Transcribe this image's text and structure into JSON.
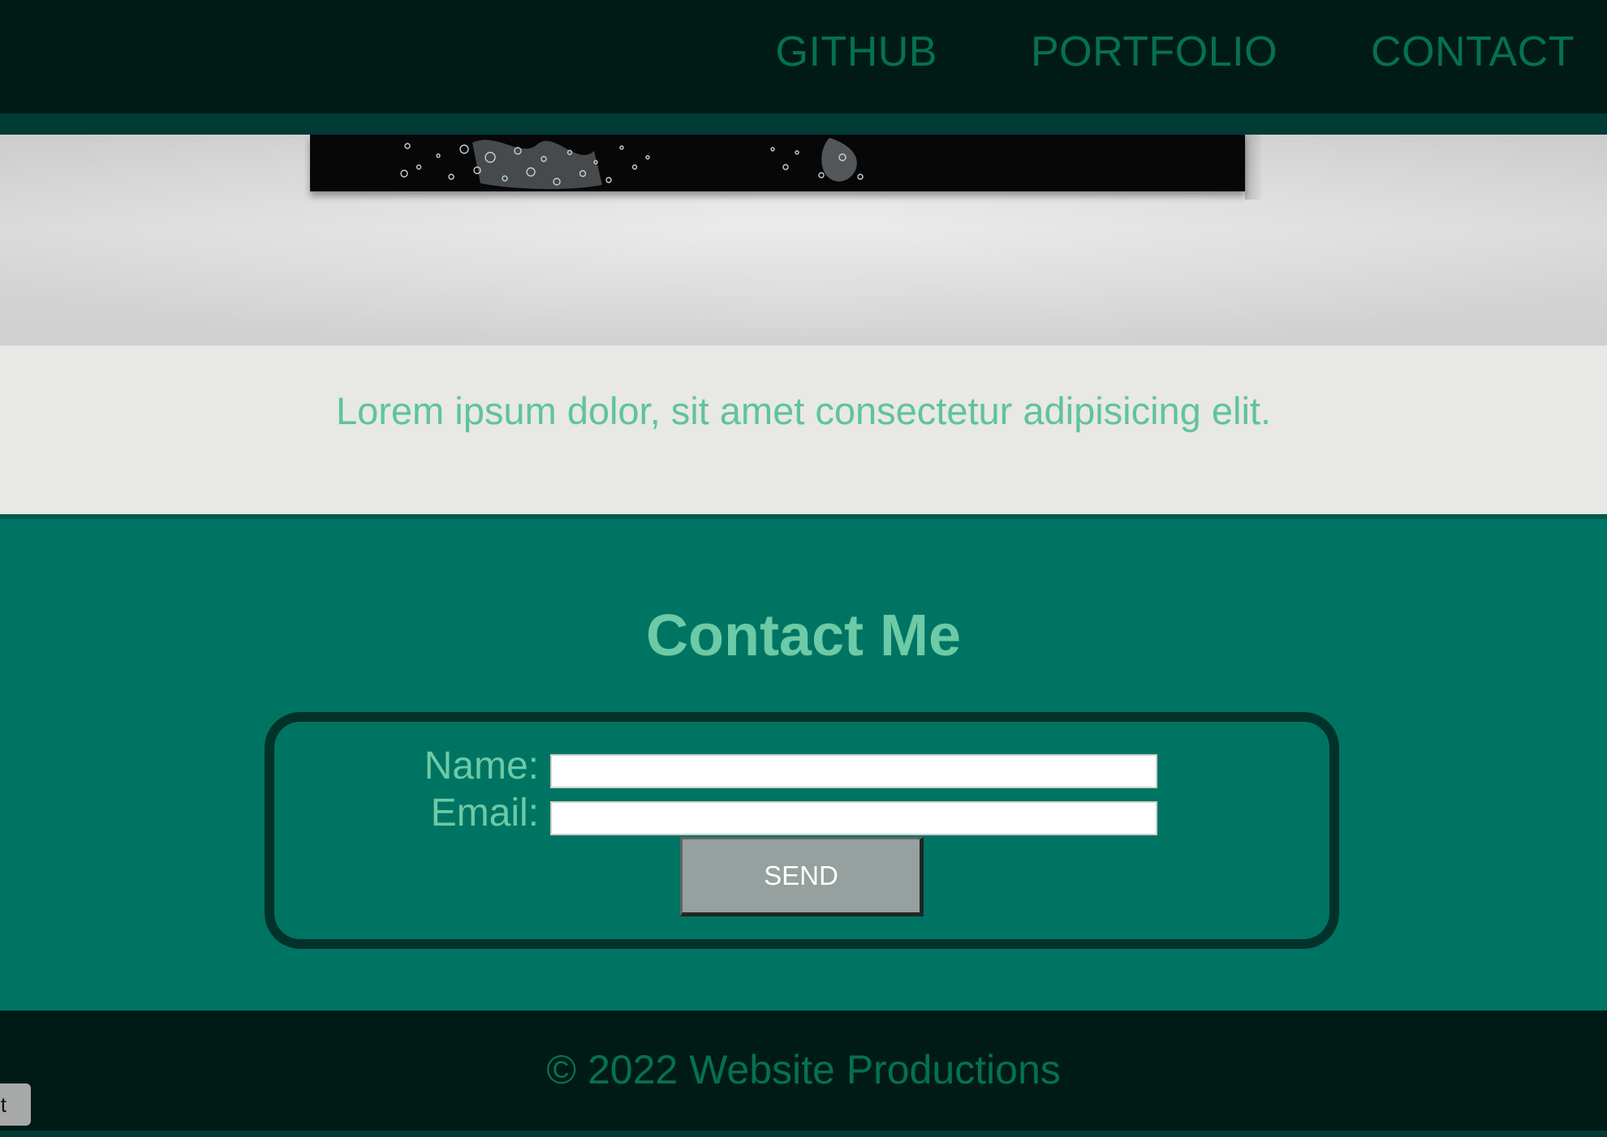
{
  "nav": {
    "items": [
      {
        "label": "GITHUB"
      },
      {
        "label": "PORTFOLIO"
      },
      {
        "label": "CONTACT"
      }
    ]
  },
  "hero": {
    "image": "water-splash-photo"
  },
  "tagline": {
    "text": "Lorem ipsum dolor, sit amet consectetur adipisicing elit."
  },
  "contact": {
    "title": "Contact Me",
    "name_label": "Name:",
    "name_value": "",
    "email_label": "Email:",
    "email_value": "",
    "send_label": "SEND"
  },
  "footer": {
    "text": "© 2022 Website Productions"
  },
  "corner_tab": {
    "text": "t"
  },
  "colors": {
    "header_bg": "#001b15",
    "nav_text": "#05714f",
    "accent_light": "#6ccaa6",
    "contact_bg": "#007463",
    "button_bg": "#96a09e"
  }
}
